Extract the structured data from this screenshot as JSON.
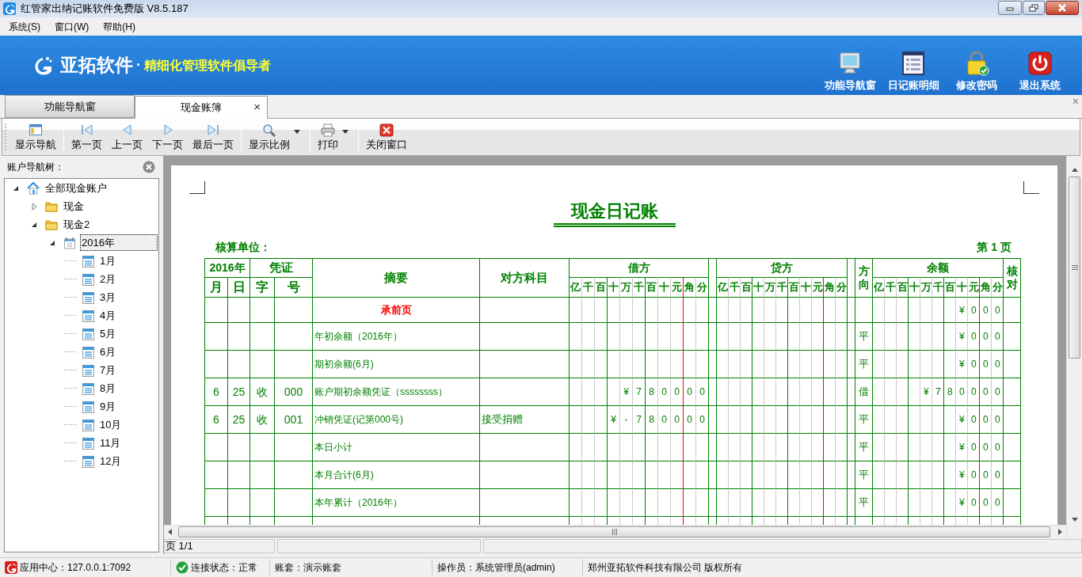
{
  "window": {
    "title": "红管家出纳记账软件免费版 V8.5.187"
  },
  "menu": [
    "系统(S)",
    "窗口(W)",
    "帮助(H)"
  ],
  "banner": {
    "brand": "亚拓软件",
    "dot": "·",
    "slogan": "精细化管理软件倡导者",
    "buttons": [
      {
        "kind": "monitor",
        "label": "功能导航窗"
      },
      {
        "kind": "list",
        "label": "日记账明细"
      },
      {
        "kind": "lock",
        "label": "修改密码"
      },
      {
        "kind": "power",
        "label": "退出系统"
      }
    ]
  },
  "tabs": [
    {
      "label": "功能导航窗",
      "selected": false
    },
    {
      "label": "现金账簿",
      "selected": true,
      "close": "×"
    }
  ],
  "tabstrip_close": "×",
  "toolbar": [
    {
      "kind": "nav",
      "label": "显示导航",
      "dropdown": false
    },
    {
      "kind": "separator"
    },
    {
      "kind": "first",
      "label": "第一页",
      "dropdown": false
    },
    {
      "kind": "prev",
      "label": "上一页",
      "dropdown": false
    },
    {
      "kind": "next",
      "label": "下一页",
      "dropdown": false
    },
    {
      "kind": "last",
      "label": "最后一页",
      "dropdown": false
    },
    {
      "kind": "separator"
    },
    {
      "kind": "zoom",
      "label": "显示比例",
      "dropdown": true
    },
    {
      "kind": "separator"
    },
    {
      "kind": "print",
      "label": "打印",
      "dropdown": true
    },
    {
      "kind": "separator"
    },
    {
      "kind": "close",
      "label": "关闭窗口",
      "dropdown": false
    }
  ],
  "tree": {
    "title": "账户导航树：",
    "items": [
      {
        "kind": "home",
        "label": "全部现金账户",
        "expanded": true,
        "selected": false,
        "children": [
          {
            "kind": "folder",
            "label": "现金",
            "expanded": false,
            "selected": false
          },
          {
            "kind": "folder",
            "label": "现金2",
            "expanded": true,
            "selected": false,
            "children": [
              {
                "kind": "calendar",
                "label": "2016年",
                "expanded": true,
                "selected": true,
                "children": [
                  {
                    "kind": "month",
                    "label": "1月",
                    "selected": false
                  },
                  {
                    "kind": "month",
                    "label": "2月",
                    "selected": false
                  },
                  {
                    "kind": "month",
                    "label": "3月",
                    "selected": false
                  },
                  {
                    "kind": "month",
                    "label": "4月",
                    "selected": false
                  },
                  {
                    "kind": "month",
                    "label": "5月",
                    "selected": false
                  },
                  {
                    "kind": "month",
                    "label": "6月",
                    "selected": false
                  },
                  {
                    "kind": "month",
                    "label": "7月",
                    "selected": false
                  },
                  {
                    "kind": "month",
                    "label": "8月",
                    "selected": false
                  },
                  {
                    "kind": "month",
                    "label": "9月",
                    "selected": false
                  },
                  {
                    "kind": "month",
                    "label": "10月",
                    "selected": false
                  },
                  {
                    "kind": "month",
                    "label": "11月",
                    "selected": false
                  },
                  {
                    "kind": "month",
                    "label": "12月",
                    "selected": false
                  }
                ]
              }
            ]
          }
        ]
      }
    ]
  },
  "ledger": {
    "title": "现金日记账",
    "unit_label": "核算单位：",
    "page_label": "第 1 页",
    "header": {
      "year": "2016年",
      "voucher": "凭证",
      "month": "月",
      "day": "日",
      "type": "字",
      "number": "号",
      "summary": "摘要",
      "account": "对方科目",
      "debit": "借方",
      "credit": "贷方",
      "direction": "方向",
      "balance": "余额",
      "check": "核对",
      "debit_units": [
        "亿",
        "千",
        "百",
        "十",
        "万",
        "千",
        "百",
        "十",
        "元",
        "角",
        "分"
      ],
      "credit_units": [
        "亿",
        "千",
        "百",
        "十",
        "万",
        "千",
        "百",
        "十",
        "元",
        "角",
        "分"
      ],
      "balance_units": [
        "亿",
        "千",
        "百",
        "十",
        "万",
        "千",
        "百",
        "十",
        "元",
        "角",
        "分"
      ]
    },
    "rows": [
      {
        "kind": "carry",
        "summary": "承前页",
        "balance": [
          "¥",
          "0",
          "0",
          "0"
        ]
      },
      {
        "kind": "entry",
        "summary": "年初余额（2016年）",
        "direction": "平",
        "balance": [
          "¥",
          "0",
          "0",
          "0"
        ]
      },
      {
        "kind": "entry",
        "summary": "期初余额(6月)",
        "direction": "平",
        "balance": [
          "¥",
          "0",
          "0",
          "0"
        ]
      },
      {
        "kind": "entry",
        "month": "6",
        "day": "25",
        "type": "收",
        "number": "000",
        "summary": "账户期初余额凭证（ssssssss）",
        "debit": [
          "¥",
          "7",
          "8",
          "0",
          "0",
          "0",
          "0"
        ],
        "direction": "借",
        "balance": [
          "¥",
          "7",
          "8",
          "0",
          "0",
          "0",
          "0"
        ]
      },
      {
        "kind": "entry",
        "month": "6",
        "day": "25",
        "type": "收",
        "number": "001",
        "summary": "冲销凭证(记第000号)",
        "account": "接受捐赠",
        "debit": [
          "¥",
          "-",
          "7",
          "8",
          "0",
          "0",
          "0",
          "0"
        ],
        "direction": "平",
        "balance": [
          "¥",
          "0",
          "0",
          "0"
        ]
      },
      {
        "kind": "entry",
        "summary": "本日小计",
        "direction": "平",
        "balance": [
          "¥",
          "0",
          "0",
          "0"
        ]
      },
      {
        "kind": "entry",
        "summary": "本月合计(6月)",
        "direction": "平",
        "balance": [
          "¥",
          "0",
          "0",
          "0"
        ]
      },
      {
        "kind": "entry",
        "summary": "本年累计（2016年）",
        "direction": "平",
        "balance": [
          "¥",
          "0",
          "0",
          "0"
        ]
      }
    ]
  },
  "pager": "页 1/1",
  "status_bar": [
    {
      "kind": "app",
      "text": "应用中心：127.0.0.1:7092"
    },
    {
      "kind": "ok",
      "text": "连接状态：正常"
    },
    {
      "kind": "plain",
      "text": "账套：演示账套"
    },
    {
      "kind": "plain",
      "text": "操作员：系统管理员(admin)"
    },
    {
      "kind": "plain",
      "text": "郑州亚拓软件科技有限公司 版权所有"
    }
  ]
}
